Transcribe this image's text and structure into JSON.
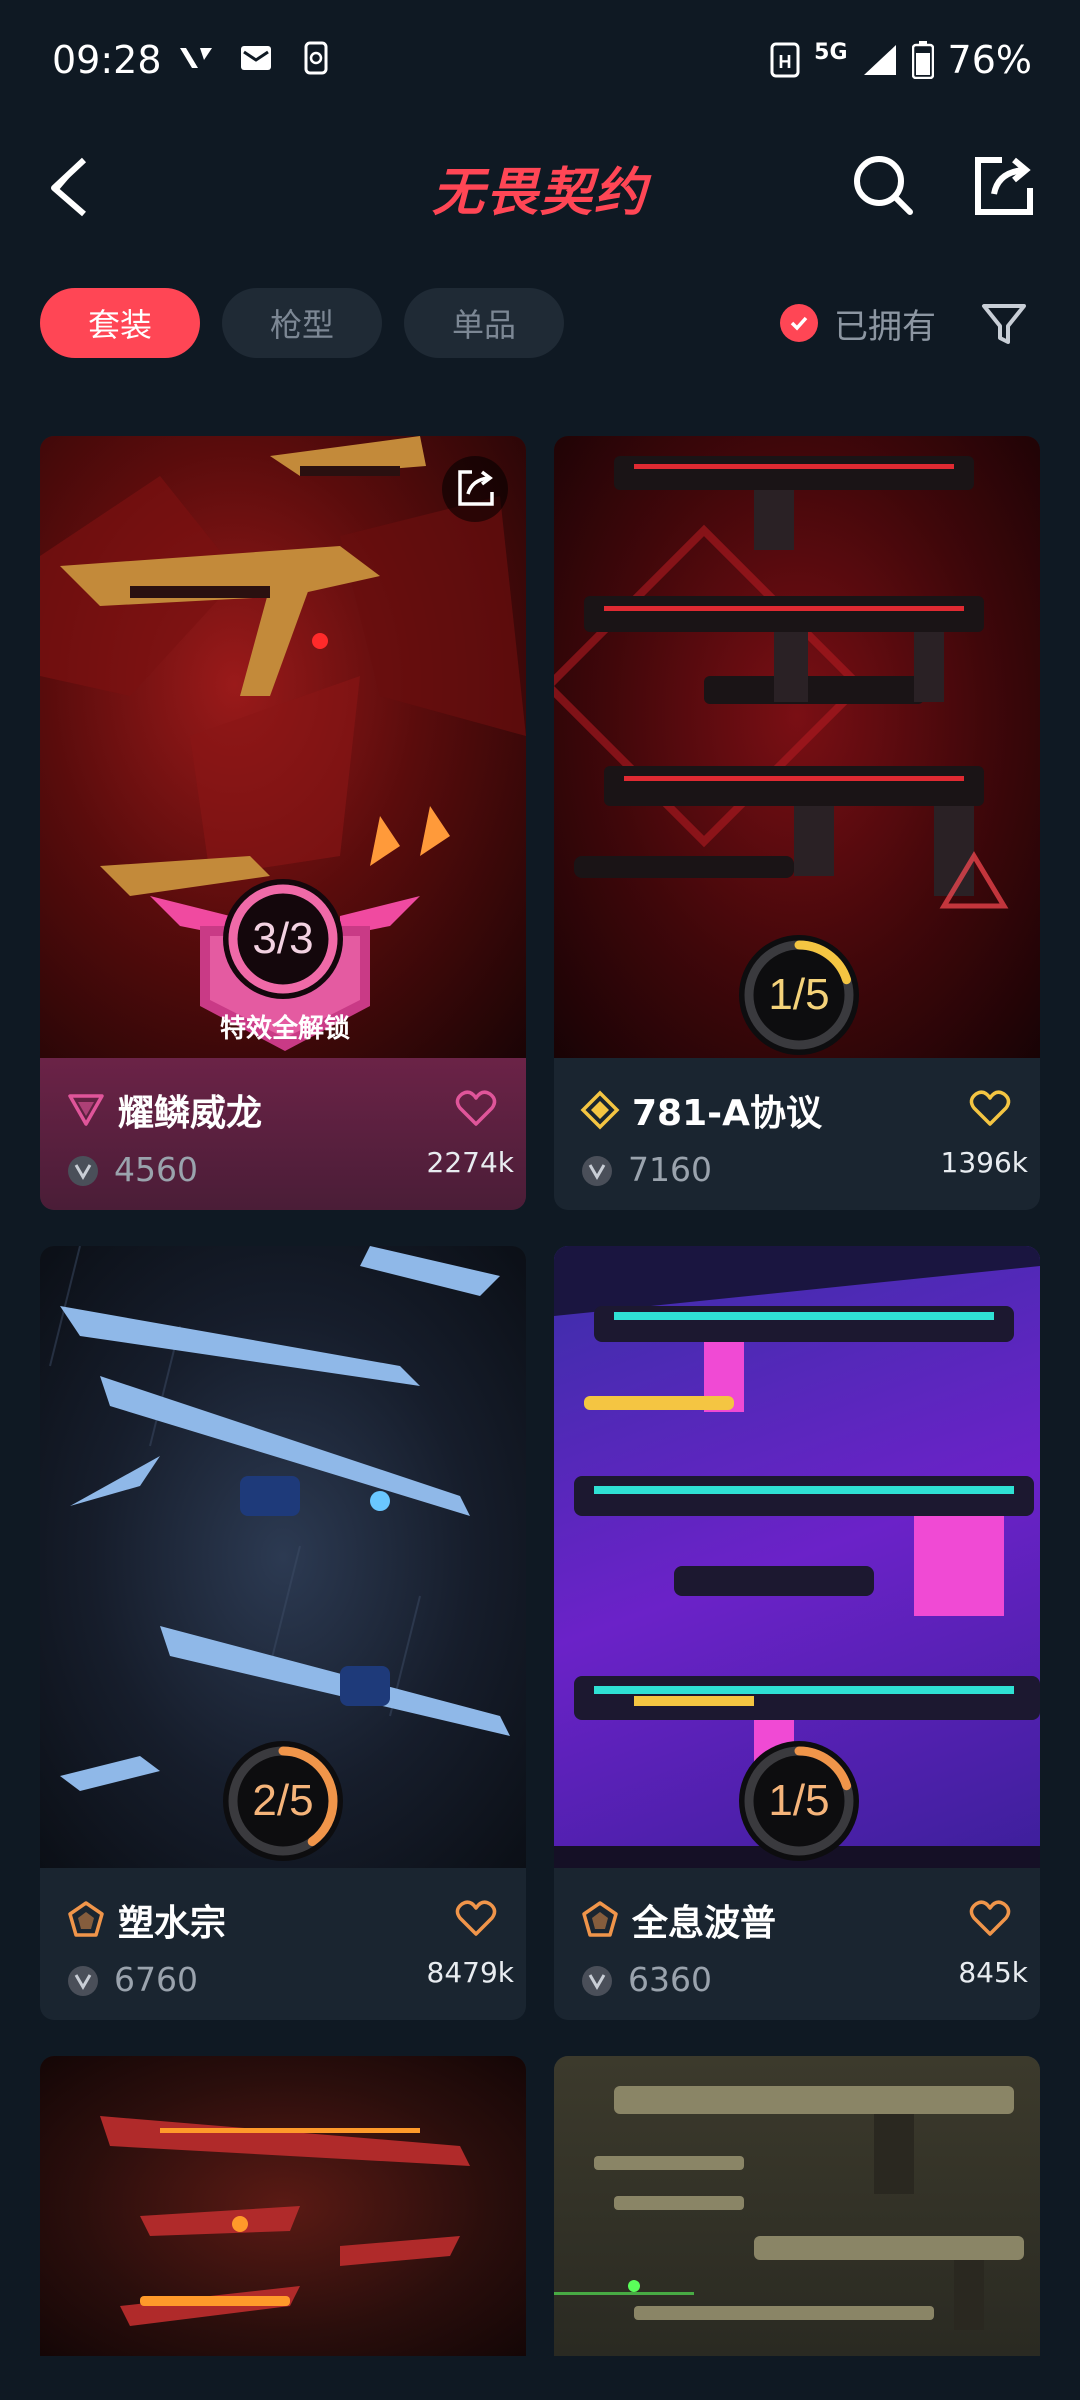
{
  "status_bar": {
    "time": "09:28",
    "network": "5G",
    "battery": "76%"
  },
  "header": {
    "title": "无畏契约",
    "back_icon": "back-arrow-icon",
    "search_icon": "search-icon",
    "share_icon": "share-icon"
  },
  "filters": {
    "tabs": [
      {
        "label": "套装",
        "active": true
      },
      {
        "label": "枪型",
        "active": false
      },
      {
        "label": "单品",
        "active": false
      }
    ],
    "owned_label": "已拥有",
    "filter_icon": "filter-icon"
  },
  "accent_color": "#ff4655",
  "cards": [
    {
      "name": "耀鳞威龙",
      "price": "4560",
      "likes": "2274k",
      "progress_text": "3/3",
      "progress": 1.0,
      "badge": "特效全解锁",
      "tier_color": "#e0559a"
    },
    {
      "name": "781-A协议",
      "price": "7160",
      "likes": "1396k",
      "progress_text": "1/5",
      "progress": 0.2,
      "tier_color": "#f4c542"
    },
    {
      "name": "塑水宗",
      "price": "6760",
      "likes": "8479k",
      "progress_text": "2/5",
      "progress": 0.4,
      "tier_color": "#f0954a"
    },
    {
      "name": "全息波普",
      "price": "6360",
      "likes": "845k",
      "progress_text": "1/5",
      "progress": 0.2,
      "tier_color": "#f0954a"
    }
  ]
}
